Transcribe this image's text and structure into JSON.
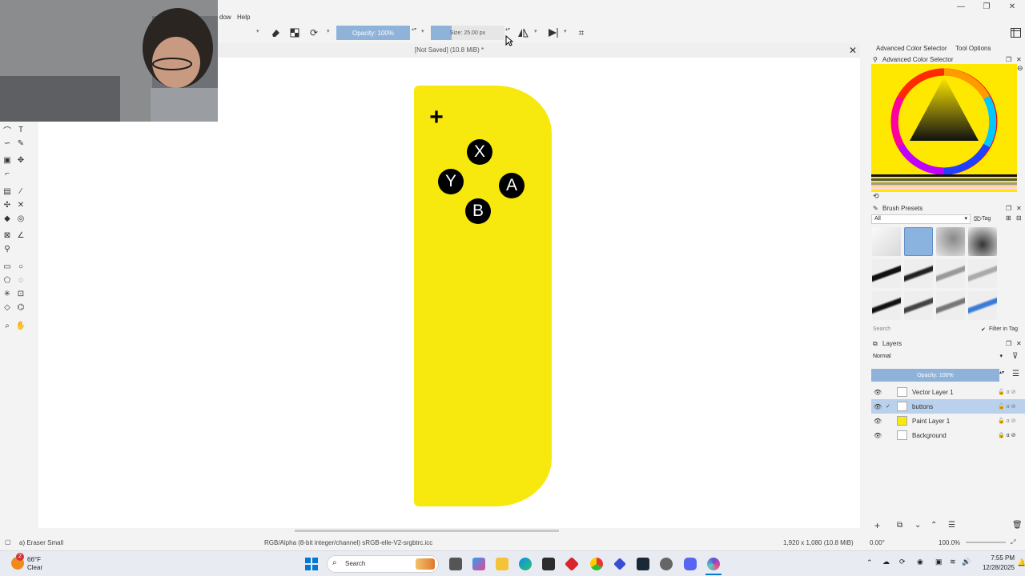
{
  "window": {
    "min_glyph": "—",
    "max_glyph": "❐",
    "close_glyph": "✕"
  },
  "menu": [
    "dow",
    "Help"
  ],
  "toolbar": {
    "opacity_label": "Opacity: 100%",
    "size_label": "Size: 25.00 px",
    "size_fraction": 0.28
  },
  "document": {
    "title": "[Not Saved]  (10.8 MiB) *",
    "close_glyph": "✕"
  },
  "artwork": {
    "body_color": "#f7e80d",
    "plus": "+",
    "buttons": [
      "X",
      "Y",
      "A",
      "B"
    ]
  },
  "dock": {
    "tabs": [
      "Advanced Color Selector",
      "Tool Options"
    ],
    "color_panel_title": "Advanced Color Selector",
    "brush_panel_title": "Brush Presets",
    "brush_filter": "All",
    "brush_tag": "Tag",
    "brush_search_placeholder": "Search",
    "filter_in_tag": "Filter in Tag",
    "layers_title": "Layers",
    "blend_mode": "Normal",
    "layer_opacity": "Opacity:  100%",
    "layers": [
      "Vector Layer 1",
      "buttons",
      "Paint Layer 1",
      "Background"
    ],
    "selected_layer": "buttons",
    "accent_color": "#b9d1ec"
  },
  "status": {
    "brush": "a) Eraser Small",
    "color_space": "RGB/Alpha (8-bit integer/channel)  sRGB-elle-V2-srgbtrc.icc",
    "image_size": "1,920 x 1,080 (10.8 MiB)",
    "rotation": "0.00°",
    "zoom": "100.0%"
  },
  "taskbar": {
    "weather_temp": "66°F",
    "weather_desc": "Clear",
    "weather_badge": "2",
    "search_label": "Search",
    "time": "7:55 PM",
    "date": "12/28/2025"
  }
}
